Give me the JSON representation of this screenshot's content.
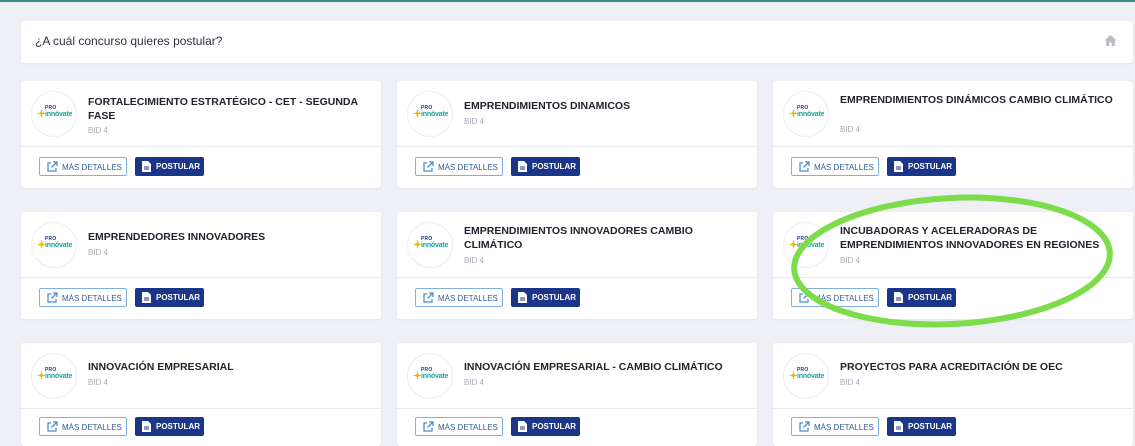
{
  "header": {
    "title": "¿A cuál concurso quieres postular?",
    "home_icon": "home-icon"
  },
  "logo": {
    "pro": "PRO",
    "innovate": "innóvate"
  },
  "buttons": {
    "details_label": "MÁS DETALLES",
    "apply_label": "POSTULAR"
  },
  "contests": [
    {
      "title": "FORTALECIMIENTO ESTRATÉGICO - CET - SEGUNDA FASE",
      "subtitle": "BID 4"
    },
    {
      "title": "EMPRENDIMIENTOS DINAMICOS",
      "subtitle": "BID 4"
    },
    {
      "title": "EMPRENDIMIENTOS DINÁMICOS CAMBIO CLIMÁTICO",
      "subtitle": "BID 4"
    },
    {
      "title": "EMPRENDEDORES INNOVADORES",
      "subtitle": "BID 4"
    },
    {
      "title": "EMPRENDIMIENTOS INNOVADORES CAMBIO CLIMÁTICO",
      "subtitle": "BID 4"
    },
    {
      "title": "INCUBADORAS Y ACELERADORAS DE EMPRENDIMIENTOS INNOVADORES EN REGIONES",
      "subtitle": "BID 4"
    },
    {
      "title": "INNOVACIÓN EMPRESARIAL",
      "subtitle": "BID 4"
    },
    {
      "title": "INNOVACIÓN EMPRESARIAL - CAMBIO CLIMÁTICO",
      "subtitle": "BID 4"
    },
    {
      "title": "PROYECTOS PARA ACREDITACIÓN DE OEC",
      "subtitle": "BID 4"
    }
  ],
  "colors": {
    "accent": "#1b3688",
    "highlight": "#7ddc4a",
    "background": "#eef0f6"
  }
}
